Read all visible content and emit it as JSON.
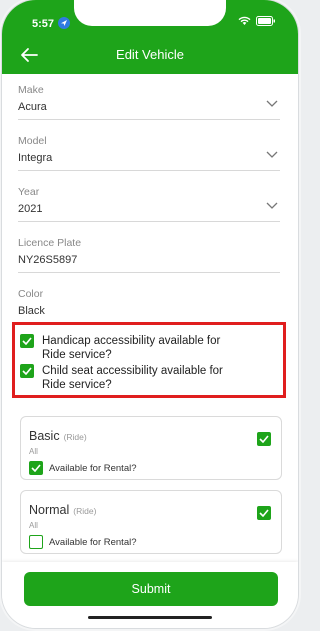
{
  "status_bar": {
    "time": "5:57"
  },
  "header": {
    "title": "Edit Vehicle"
  },
  "fields": [
    {
      "label": "Make",
      "value": "Acura"
    },
    {
      "label": "Model",
      "value": "Integra"
    },
    {
      "label": "Year",
      "value": "2021"
    },
    {
      "label": "Licence Plate",
      "value": "NY26S5897"
    },
    {
      "label": "Color",
      "value": "Black"
    }
  ],
  "accessibility": [
    {
      "label": "Handicap accessibility available for Ride service?",
      "checked": true
    },
    {
      "label": "Child seat accessibility available for Ride service?",
      "checked": true
    }
  ],
  "services": [
    {
      "name": "Basic",
      "tag": "(Ride)",
      "sub": "All",
      "checked": true,
      "rental_label": "Available for Rental?",
      "rental_checked": true
    },
    {
      "name": "Normal",
      "tag": "(Ride)",
      "sub": "All",
      "checked": true,
      "rental_label": "Available for Rental?",
      "rental_checked": false
    }
  ],
  "submit_label": "Submit",
  "colors": {
    "brand_green": "#1ea41a",
    "highlight_red": "#e01e1e"
  }
}
